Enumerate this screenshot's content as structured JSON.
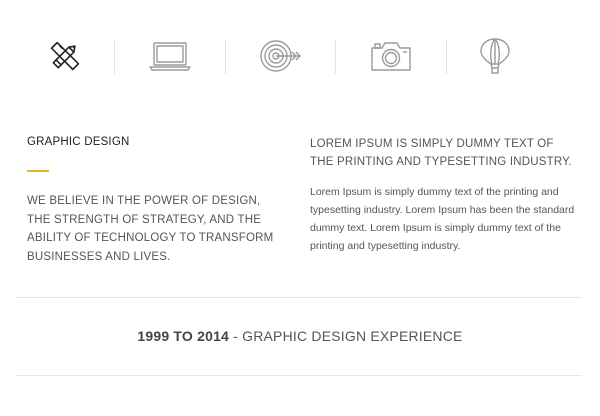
{
  "icons": [
    {
      "name": "pencil-ruler-icon",
      "active": true
    },
    {
      "name": "laptop-icon",
      "active": false
    },
    {
      "name": "target-icon",
      "active": false
    },
    {
      "name": "camera-icon",
      "active": false
    },
    {
      "name": "hot-air-balloon-icon",
      "active": false
    }
  ],
  "colors": {
    "accent": "#e6b422",
    "active_icon": "#222222",
    "inactive_icon": "#9a9a9a"
  },
  "left": {
    "title": "GRAPHIC DESIGN",
    "body": "WE BELIEVE IN THE POWER OF DESIGN, THE STRENGTH OF STRATEGY, AND THE ABILITY OF TECHNOLOGY TO TRANSFORM BUSINESSES AND LIVES."
  },
  "right": {
    "heading": "LOREM IPSUM IS SIMPLY DUMMY TEXT OF THE PRINTING AND TYPESETTING INDUSTRY.",
    "body": "Lorem Ipsum is simply dummy text of the printing and typesetting industry. Lorem Ipsum has been the standard dummy text. Lorem Ipsum is simply dummy text of the printing and typesetting industry."
  },
  "experience": {
    "years": "1999 TO 2014",
    "label": " - GRAPHIC DESIGN EXPERIENCE"
  }
}
